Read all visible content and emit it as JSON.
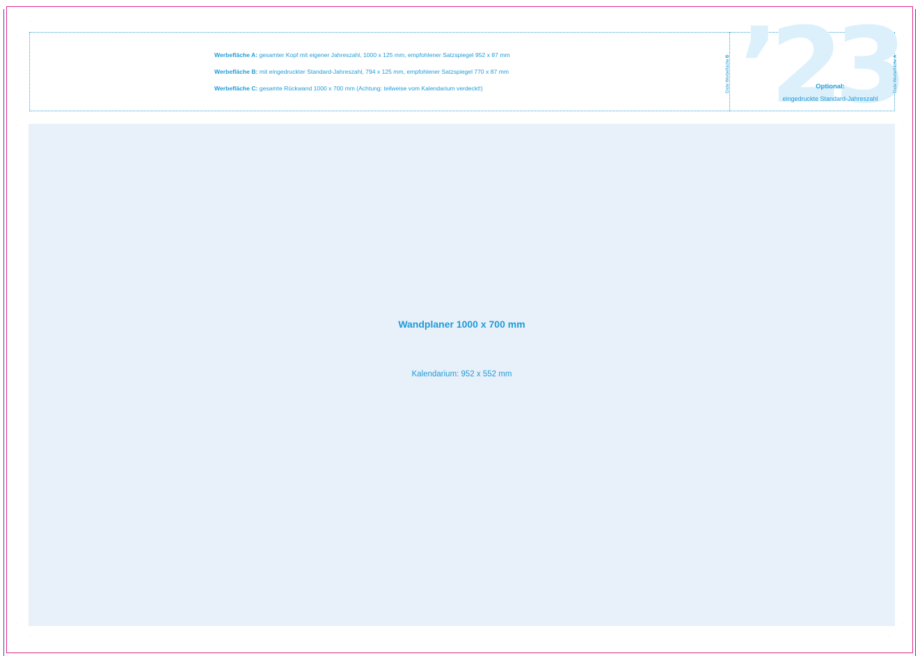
{
  "info": {
    "a_label": "Werbefläche A:",
    "a_text": " gesamter Kopf mit eigener Jahreszahl, 1000 x 125 mm, empfohlener Satzspiegel 952 x 87 mm",
    "b_label": "Werbefläche B:",
    "b_text": " mit eingedruckter Standard-Jahreszahl, 794 x 125 mm, empfohlener Satzspiegel 770 x 87 mm",
    "c_label": "Werbefläche C:",
    "c_text": " gesamte Rückwand 1000 x 700 mm (Achtung: teilweise vom Kalendarium verdeckt!)"
  },
  "year_badge": {
    "year": "’23",
    "optional_title": "Optional:",
    "optional_text": "eingedruckte Standard-Jahreszahl"
  },
  "vertical_labels": {
    "end_b_prefix": "Ende Werbefläche ",
    "end_b_letter": "B",
    "end_a_prefix": "Ende Werbefläche ",
    "end_a_letter": "A"
  },
  "main": {
    "title": "Wandplaner 1000 x 700 mm",
    "subtitle": "Kalendarium: 952 x 552 mm"
  },
  "colors": {
    "accent": "#1e9bd7",
    "area_bg": "#e8f0fa",
    "crop_marks": "#e0218a",
    "year_tint": "#dcf0fb"
  }
}
